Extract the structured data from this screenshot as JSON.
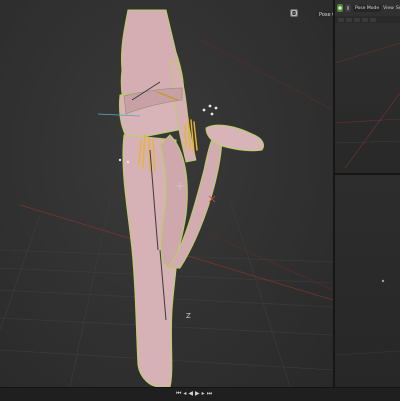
{
  "viewport": {
    "header": {
      "pose_options_label": "Pose Options",
      "icons": [
        "view-layers-icon",
        "object-icon"
      ]
    },
    "axis_label": "Z"
  },
  "right_panel": {
    "mode_label": "Pose Mode",
    "view_menu_label": "View",
    "select_menu_label": "Se"
  },
  "timeline": {
    "controls": [
      "jump-start-icon",
      "step-back-icon",
      "play-reverse-icon",
      "play-icon",
      "step-forward-icon",
      "jump-end-icon"
    ]
  },
  "colors": {
    "viewport_bg": "#323232",
    "skin": "#d9b5ba",
    "selection_outline": "#b8d060",
    "bones_yellow": "#e6b62e",
    "grid_red": "#8a3b3b",
    "active_mode": "#4a8a2a"
  }
}
